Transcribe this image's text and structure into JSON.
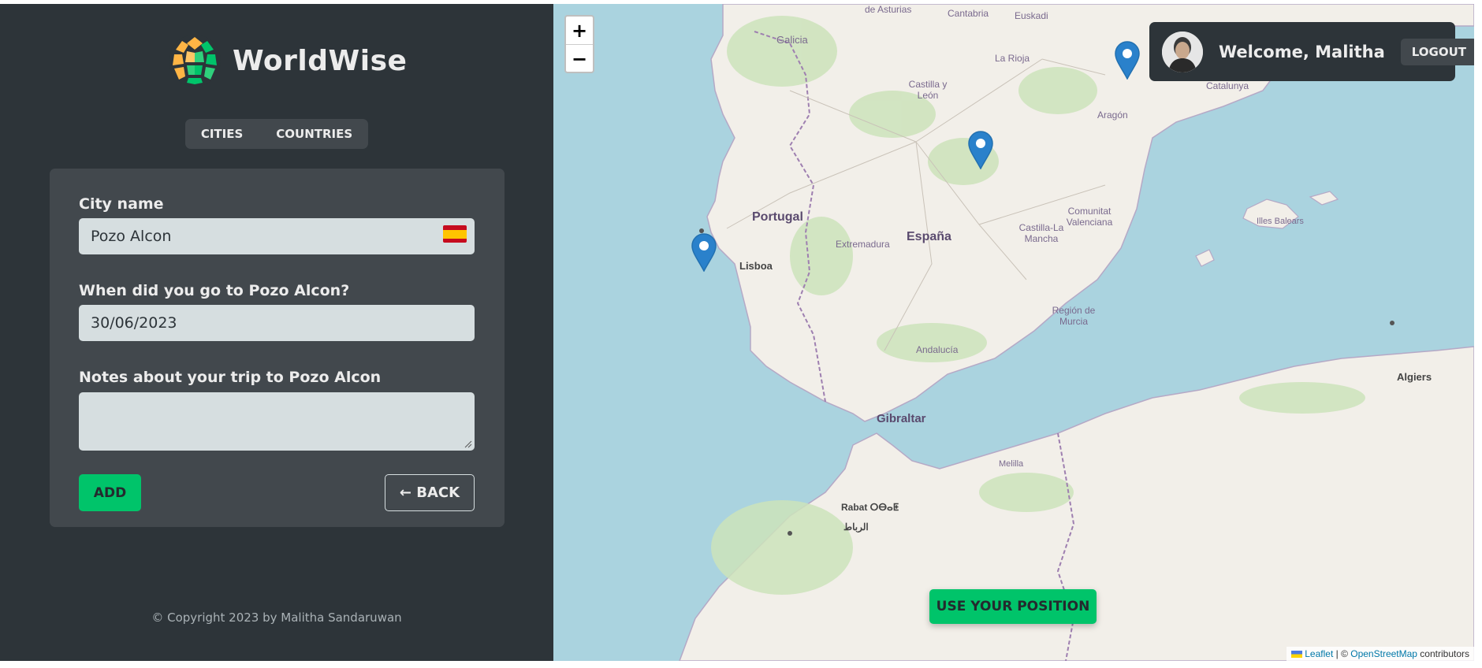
{
  "app": {
    "brand": "WorldWise"
  },
  "nav": {
    "cities": "CITIES",
    "countries": "COUNTRIES"
  },
  "form": {
    "city_label": "City name",
    "city_value": "Pozo Alcon",
    "date_label": "When did you go to Pozo Alcon?",
    "date_value": "30/06/2023",
    "notes_label": "Notes about your trip to Pozo Alcon",
    "notes_value": "",
    "add_label": "ADD",
    "back_label": "← BACK",
    "flag_icon": "spain-flag-icon"
  },
  "footer": {
    "copyright": "© Copyright 2023 by Malitha Sandaruwan"
  },
  "map": {
    "zoom_in": "+",
    "zoom_out": "−",
    "use_position": "USE YOUR POSITION",
    "labels": {
      "galicia": "Galicia",
      "asturias": "de Asturias",
      "cantabria": "Cantabria",
      "euskadi": "Euskadi",
      "rioja": "La Rioja",
      "castilla_leon": "Castilla y León",
      "aragon": "Aragón",
      "catalunya": "Catalunya",
      "portugal": "Portugal",
      "espana": "España",
      "extremadura": "Extremadura",
      "castilla_mancha": "Castilla-La Mancha",
      "valenciana": "Comunitat Valenciana",
      "baleares": "Illes Balears",
      "lisboa": "Lisboa",
      "murcia": "Región de Murcia",
      "andalucia": "Andalucía",
      "gibraltar": "Gibraltar",
      "algiers": "Algiers",
      "melilla": "Melilla",
      "rabat": "Rabat ⵔⴱⴰⵟ",
      "rabat_ar": "الرباط"
    },
    "markers": [
      "marker-lisboa",
      "marker-madrid",
      "marker-zaragoza"
    ],
    "attribution": {
      "leaflet": "Leaflet",
      "sep": " | © ",
      "osm": "OpenStreetMap",
      "contributors": " contributors"
    }
  },
  "user": {
    "welcome": "Welcome, Malitha",
    "logout": "LOGOUT"
  },
  "colors": {
    "sidebar_bg": "#2d3439",
    "panel_bg": "#42484d",
    "field_bg": "#d6dee0",
    "accent_green": "#00c46a",
    "sea": "#aad3df"
  }
}
